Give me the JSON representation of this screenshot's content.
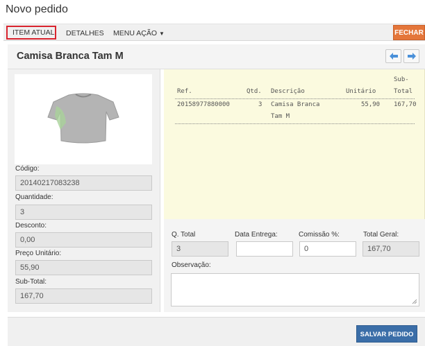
{
  "page": {
    "title": "Novo pedido"
  },
  "toolbar": {
    "tab_item_atual": "ITEM ATUAL",
    "tab_detalhes": "DETALHES",
    "tab_menu_acao": "MENU AÇÃO",
    "fechar": "FECHAR"
  },
  "product": {
    "title": "Camisa Branca Tam M"
  },
  "left": {
    "codigo_label": "Código:",
    "codigo_value": "20140217083238",
    "quantidade_label": "Quantidade:",
    "quantidade_value": "3",
    "desconto_label": "Desconto:",
    "desconto_value": "0,00",
    "preco_label": "Preço Unitário:",
    "preco_value": "55,90",
    "subtotal_label": "Sub-Total:",
    "subtotal_value": "167,70"
  },
  "items_table": {
    "headers": {
      "ref": "Ref.",
      "qtd": "Qtd.",
      "descricao": "Descrição",
      "unitario": "Unitário",
      "subtotal_line1": "Sub-",
      "subtotal_line2": "Total"
    },
    "rows": [
      {
        "ref": "20158977880000",
        "qtd": "3",
        "descricao_line1": "Camisa Branca",
        "descricao_line2": "Tam M",
        "unitario": "55,90",
        "subtotal": "167,70"
      }
    ]
  },
  "bottom": {
    "qtotal_label": "Q. Total",
    "qtotal_value": "3",
    "data_entrega_label": "Data Entrega:",
    "data_entrega_value": "",
    "comissao_label": "Comissão %:",
    "comissao_value": "0",
    "total_geral_label": "Total Geral:",
    "total_geral_value": "167,70",
    "observacao_label": "Observação:",
    "observacao_value": ""
  },
  "footer": {
    "salvar": "SALVAR PEDIDO"
  },
  "icons": {
    "prev": "arrow-left-icon",
    "next": "arrow-right-icon",
    "dropdown": "caret-down-icon",
    "product_image": "t-shirt-image"
  }
}
